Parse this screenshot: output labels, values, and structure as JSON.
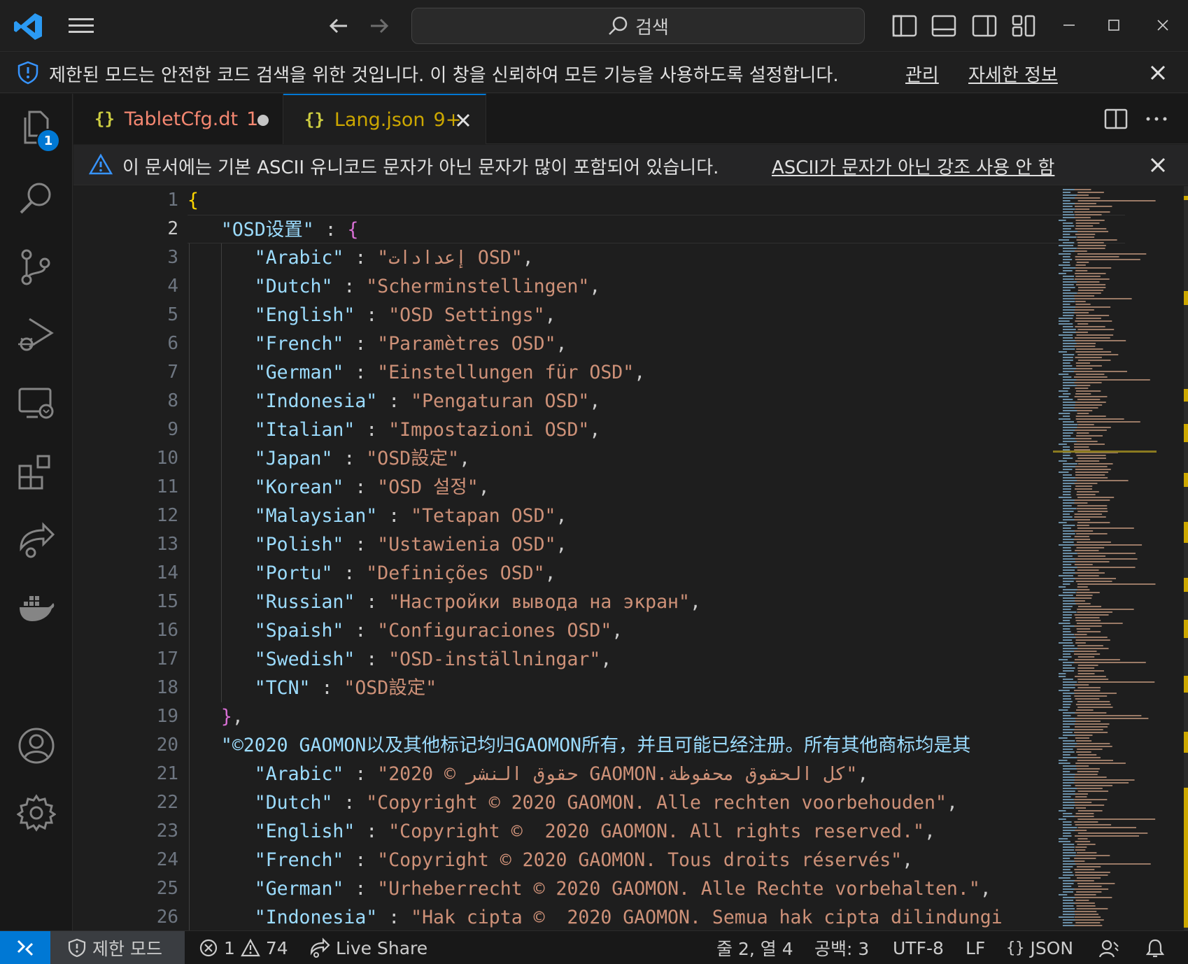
{
  "search": {
    "label": "검색"
  },
  "banner": {
    "message": "제한된 모드는 안전한 코드 검색을 위한 것입니다. 이 창을 신뢰하여 모든 기능을 사용하도록 설정합니다.",
    "manage_link": "관리",
    "learn_more_link": "자세한 정보"
  },
  "activity": {
    "explorer_badge": "1"
  },
  "tabs": [
    {
      "name": "TabletCfg.dt",
      "count": "1",
      "state": "modified"
    },
    {
      "name": "Lang.json",
      "count": "9+",
      "state": "active"
    }
  ],
  "unicode_warning": {
    "message": "이 문서에는 기본 ASCII 유니코드 문자가 아닌 문자가 많이 포함되어 있습니다.",
    "disable_link": "ASCII가 문자가 아닌 강조 사용 안 함"
  },
  "editor": {
    "line_numbers": [
      "1",
      "2",
      "3",
      "4",
      "5",
      "6",
      "7",
      "8",
      "9",
      "10",
      "11",
      "12",
      "13",
      "14",
      "15",
      "16",
      "17",
      "18",
      "19",
      "20",
      "21",
      "22",
      "23",
      "24",
      "25",
      "26"
    ],
    "lines": [
      {
        "indent": "",
        "key": "",
        "sep": "",
        "value": "",
        "tail": "",
        "open": "{"
      },
      {
        "indent": "   ",
        "key": "\"OSD设置\"",
        "sep": " : ",
        "value": "",
        "tail": "",
        "open": "{"
      },
      {
        "indent": "      ",
        "key": "\"Arabic\"",
        "sep": " : ",
        "value": "\"إعدادات OSD\"",
        "tail": ",",
        "open": ""
      },
      {
        "indent": "      ",
        "key": "\"Dutch\"",
        "sep": " : ",
        "value": "\"Scherminstellingen\"",
        "tail": ",",
        "open": ""
      },
      {
        "indent": "      ",
        "key": "\"English\"",
        "sep": " : ",
        "value": "\"OSD Settings\"",
        "tail": ",",
        "open": ""
      },
      {
        "indent": "      ",
        "key": "\"French\"",
        "sep": " : ",
        "value": "\"Paramètres OSD\"",
        "tail": ",",
        "open": ""
      },
      {
        "indent": "      ",
        "key": "\"German\"",
        "sep": " : ",
        "value": "\"Einstellungen für OSD\"",
        "tail": ",",
        "open": ""
      },
      {
        "indent": "      ",
        "key": "\"Indonesia\"",
        "sep": " : ",
        "value": "\"Pengaturan OSD\"",
        "tail": ",",
        "open": ""
      },
      {
        "indent": "      ",
        "key": "\"Italian\"",
        "sep": " : ",
        "value": "\"Impostazioni OSD\"",
        "tail": ",",
        "open": ""
      },
      {
        "indent": "      ",
        "key": "\"Japan\"",
        "sep": " : ",
        "value": "\"OSD設定\"",
        "tail": ",",
        "open": ""
      },
      {
        "indent": "      ",
        "key": "\"Korean\"",
        "sep": " : ",
        "value": "\"OSD 설정\"",
        "tail": ",",
        "open": ""
      },
      {
        "indent": "      ",
        "key": "\"Malaysian\"",
        "sep": " : ",
        "value": "\"Tetapan OSD\"",
        "tail": ",",
        "open": ""
      },
      {
        "indent": "      ",
        "key": "\"Polish\"",
        "sep": " : ",
        "value": "\"Ustawienia OSD\"",
        "tail": ",",
        "open": ""
      },
      {
        "indent": "      ",
        "key": "\"Portu\"",
        "sep": " : ",
        "value": "\"Definições OSD\"",
        "tail": ",",
        "open": ""
      },
      {
        "indent": "      ",
        "key": "\"Russian\"",
        "sep": " : ",
        "value": "\"Настройки вывода на экран\"",
        "tail": ",",
        "open": ""
      },
      {
        "indent": "      ",
        "key": "\"Spaish\"",
        "sep": " : ",
        "value": "\"Configuraciones OSD\"",
        "tail": ",",
        "open": ""
      },
      {
        "indent": "      ",
        "key": "\"Swedish\"",
        "sep": " : ",
        "value": "\"OSD-inställningar\"",
        "tail": ",",
        "open": ""
      },
      {
        "indent": "      ",
        "key": "\"TCN\"",
        "sep": " : ",
        "value": "\"OSD設定\"",
        "tail": "",
        "open": ""
      },
      {
        "indent": "   ",
        "key": "",
        "sep": "",
        "value": "",
        "tail": "",
        "close": "}",
        "after": ","
      },
      {
        "indent": "   ",
        "key": "\"©2020 GAOMON以及其他标记均归GAOMON所有，并且可能已经注册。所有其他商标均是其",
        "sep": "",
        "value": "",
        "tail": "",
        "open": ""
      },
      {
        "indent": "      ",
        "key": "\"Arabic\"",
        "sep": " : ",
        "value": "\"2020 © حقوق النشر GAOMON.كل الحقوق محفوظة\"",
        "tail": ",",
        "open": ""
      },
      {
        "indent": "      ",
        "key": "\"Dutch\"",
        "sep": " : ",
        "value": "\"Copyright © 2020 GAOMON. Alle rechten voorbehouden\"",
        "tail": ",",
        "open": ""
      },
      {
        "indent": "      ",
        "key": "\"English\"",
        "sep": " : ",
        "value": "\"Copyright ©  2020 GAOMON. All rights reserved.\"",
        "tail": ",",
        "open": ""
      },
      {
        "indent": "      ",
        "key": "\"French\"",
        "sep": " : ",
        "value": "\"Copyright © 2020 GAOMON. Tous droits réservés\"",
        "tail": ",",
        "open": ""
      },
      {
        "indent": "      ",
        "key": "\"German\"",
        "sep": " : ",
        "value": "\"Urheberrecht © 2020 GAOMON. Alle Rechte vorbehalten.\"",
        "tail": ",",
        "open": ""
      },
      {
        "indent": "      ",
        "key": "\"Indonesia\"",
        "sep": " : ",
        "value": "\"Hak cipta ©  2020 GAOMON. Semua hak cipta dilindungi",
        "tail": "",
        "open": ""
      }
    ]
  },
  "status": {
    "restricted_mode": "제한 모드",
    "errors": "1",
    "warnings": "74",
    "live_share": "Live Share",
    "cursor": "줄 2, 열 4",
    "spaces": "공백: 3",
    "encoding": "UTF-8",
    "eol": "LF",
    "language": "JSON"
  },
  "colors": {
    "accent": "#0078d4",
    "tab_modified": "#f48771",
    "tab_active": "#cca700",
    "json_key": "#9cdcfe",
    "json_string": "#ce9178"
  }
}
